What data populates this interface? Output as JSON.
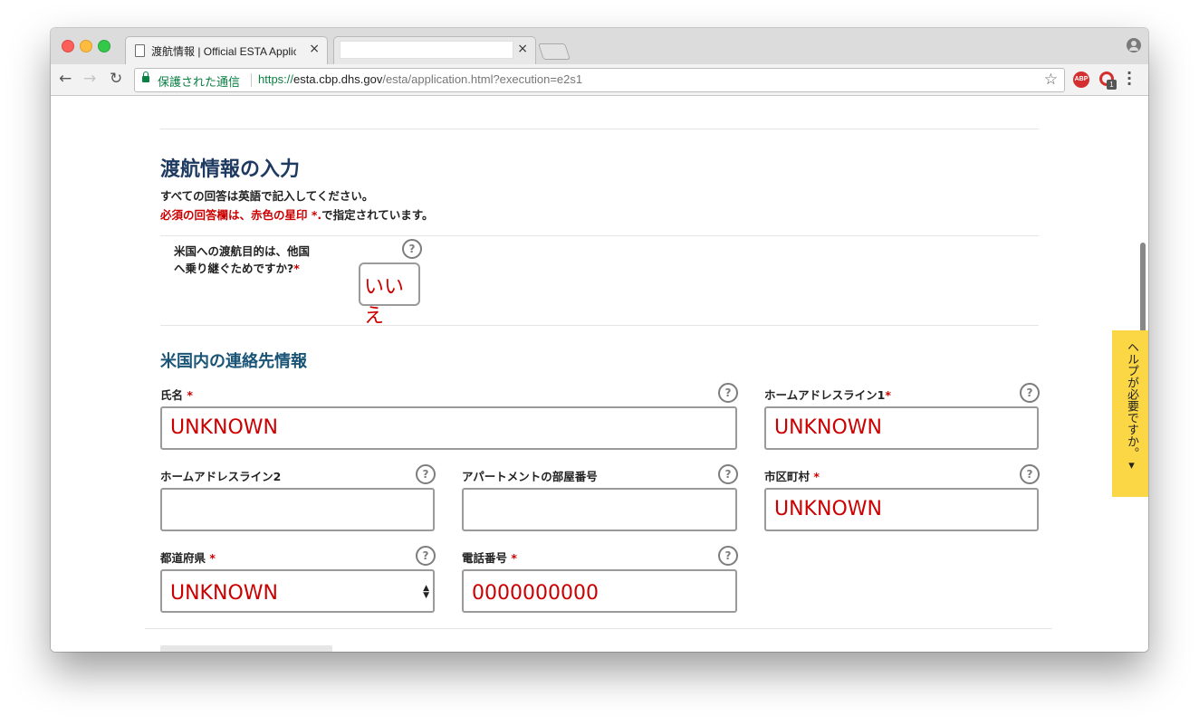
{
  "browser": {
    "tab_active_title": "渡航情報 | Official ESTA Applic",
    "tab_close": "×",
    "omnibox": {
      "secure_label": "保護された通信",
      "url_scheme": "https://",
      "url_host": "esta.cbp.dhs.gov",
      "url_path": "/esta/application.html?execution=e2s1"
    },
    "ext_abp_label": "ABP",
    "ext_badge_count": "1"
  },
  "page": {
    "travel_section": {
      "title": "渡航情報の入力",
      "intro_line1": "すべての回答は英語で記入してください。",
      "intro_req": "必須の回答欄は、赤色の星印 *.",
      "intro_req_tail": "で指定されています。",
      "question_line1": "米国への渡航目的は、他国",
      "question_line2": "へ乗り継ぐためですか?",
      "question_answer": "いいえ"
    },
    "contact_section": {
      "title": "米国内の連絡先情報",
      "fields": {
        "name": {
          "label": "氏名",
          "value": "UNKNOWN"
        },
        "address1": {
          "label": "ホームアドレスライン1",
          "value": "UNKNOWN"
        },
        "address2": {
          "label": "ホームアドレスライン2",
          "value": ""
        },
        "apartment": {
          "label": "アパートメントの部屋番号",
          "value": ""
        },
        "city": {
          "label": "市区町村",
          "value": "UNKNOWN"
        },
        "state": {
          "label": "都道府県",
          "value": "UNKNOWN"
        },
        "phone": {
          "label": "電話番号",
          "value": "0000000000"
        }
      }
    },
    "required_mark": "*",
    "help_glyph": "?",
    "help_tab_label": "ヘルプが必要ですか。▾"
  },
  "colors": {
    "heading": "#1f3a60",
    "required": "#cc0000",
    "help_tab": "#fbd645"
  }
}
